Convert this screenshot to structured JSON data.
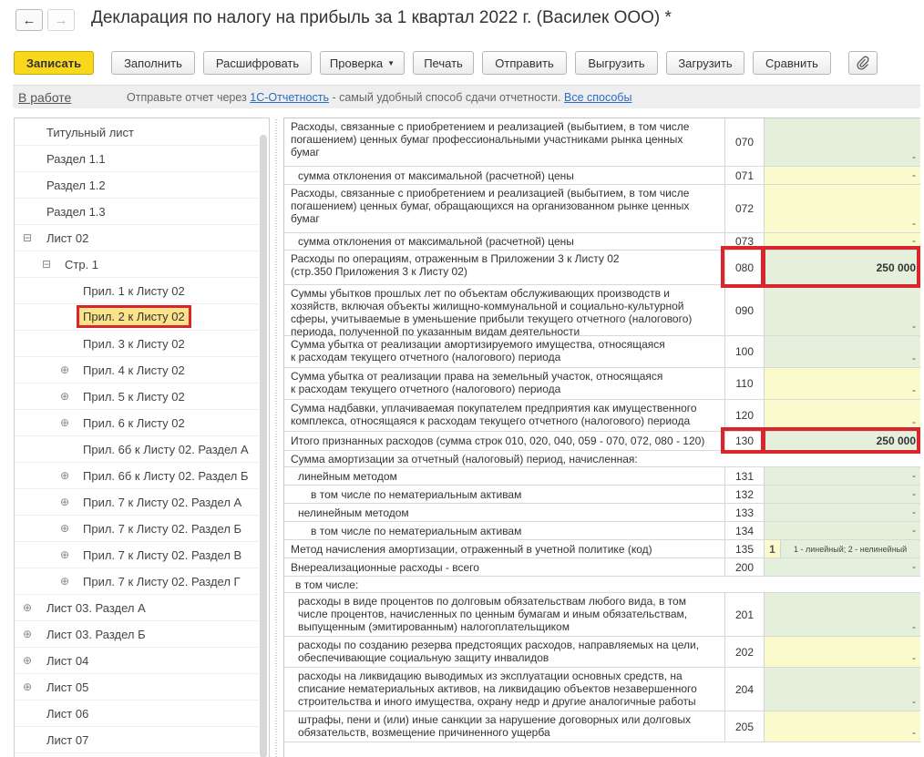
{
  "window": {
    "title": "Декларация по налогу на прибыль за 1 квартал 2022 г. (Василек ООО) *",
    "back_glyph": "←",
    "forward_glyph": "→"
  },
  "toolbar": {
    "save": "Записать",
    "fill": "Заполнить",
    "decode": "Расшифровать",
    "check": "Проверка",
    "print": "Печать",
    "send": "Отправить",
    "export": "Выгрузить",
    "import": "Загрузить",
    "compare": "Сравнить",
    "attach_icon": "paperclip-icon"
  },
  "status": {
    "state": "В работе",
    "message_prefix": "Отправьте отчет через ",
    "message_link": "1С-Отчетность",
    "message_suffix": " - самый удобный способ сдачи отчетности. ",
    "all_ways": "Все способы"
  },
  "tree": {
    "items": [
      {
        "label": "Титульный лист",
        "expander": ""
      },
      {
        "label": "Раздел 1.1",
        "expander": ""
      },
      {
        "label": "Раздел 1.2",
        "expander": ""
      },
      {
        "label": "Раздел 1.3",
        "expander": ""
      },
      {
        "label": "Лист 02",
        "expander": "⊟"
      },
      {
        "label": "Стр. 1",
        "expander": "⊟"
      },
      {
        "label": "Прил. 1 к Листу 02",
        "expander": ""
      },
      {
        "label": "Прил. 2 к Листу 02",
        "expander": "",
        "selected": true
      },
      {
        "label": "Прил. 3 к Листу 02",
        "expander": ""
      },
      {
        "label": "Прил. 4 к Листу 02",
        "expander": "⊕"
      },
      {
        "label": "Прил. 5 к Листу 02",
        "expander": "⊕"
      },
      {
        "label": "Прил. 6 к Листу 02",
        "expander": "⊕"
      },
      {
        "label": "Прил. 6б к Листу 02. Раздел А",
        "expander": ""
      },
      {
        "label": "Прил. 6б к Листу 02. Раздел Б",
        "expander": "⊕"
      },
      {
        "label": "Прил. 7 к Листу 02. Раздел А",
        "expander": "⊕"
      },
      {
        "label": "Прил. 7 к Листу 02. Раздел Б",
        "expander": "⊕"
      },
      {
        "label": "Прил. 7 к Листу 02. Раздел В",
        "expander": "⊕"
      },
      {
        "label": "Прил. 7 к Листу 02. Раздел Г",
        "expander": "⊕"
      },
      {
        "label": "Лист 03. Раздел А",
        "expander": "⊕"
      },
      {
        "label": "Лист 03. Раздел Б",
        "expander": "⊕"
      },
      {
        "label": "Лист 04",
        "expander": "⊕"
      },
      {
        "label": "Лист 05",
        "expander": "⊕"
      },
      {
        "label": "Лист 06",
        "expander": ""
      },
      {
        "label": "Лист 07",
        "expander": ""
      }
    ]
  },
  "form": {
    "rows": [
      {
        "lines": [
          "Расходы, связанные с приобретением и реализацией (выбытием, в том числе",
          "погашением) ценных бумаг профессиональными участниками рынка ценных",
          "бумаг"
        ],
        "code": "070",
        "value": "-",
        "color": "green"
      },
      {
        "lines": [
          "сумма отклонения от максимальной (расчетной) цены"
        ],
        "code": "071",
        "value": "-",
        "color": "yellow",
        "indent": 1
      },
      {
        "lines": [
          "Расходы, связанные с приобретением и реализацией (выбытием, в том числе",
          "погашением) ценных бумаг, обращающихся на организованном рынке ценных",
          "бумаг"
        ],
        "code": "072",
        "value": "-",
        "color": "yellow"
      },
      {
        "lines": [
          "сумма отклонения от максимальной (расчетной) цены"
        ],
        "code": "073",
        "value": "-",
        "color": "yellow",
        "indent": 1
      },
      {
        "lines": [
          "Расходы по операциям, отраженным в Приложении 3 к Листу 02",
          "(стр.350 Приложения 3 к Листу 02)"
        ],
        "code": "080",
        "value": "250 000",
        "color": "green",
        "bold": true,
        "highlight": true
      },
      {
        "lines": [
          "Суммы убытков прошлых лет по объектам обслуживающих производств и",
          "хозяйств, включая объекты жилищно-коммунальной и социально-культурной",
          "сферы, учитываемые в уменьшение прибыли текущего отчетного (налогового)",
          "периода, полученной по указанным видам деятельности"
        ],
        "code": "090",
        "value": "-",
        "color": "green"
      },
      {
        "lines": [
          "Сумма убытка от реализации амортизируемого имущества, относящаяся",
          "к расходам текущего отчетного (налогового) периода"
        ],
        "code": "100",
        "value": "-",
        "color": "green"
      },
      {
        "lines": [
          "Сумма убытка от реализации права на земельный участок, относящаяся",
          "к расходам текущего отчетного (налогового) периода"
        ],
        "code": "110",
        "value": "-",
        "color": "yellow"
      },
      {
        "lines": [
          "Сумма надбавки, уплачиваемая покупателем предприятия как имущественного",
          "комплекса, относящаяся к расходам текущего отчетного (налогового) периода"
        ],
        "code": "120",
        "value": "-",
        "color": "yellow"
      },
      {
        "lines": [
          "Итого признанных расходов (сумма строк 010, 020, 040, 059 - 070, 072, 080 - 120)"
        ],
        "code": "130",
        "value": "250 000",
        "color": "green",
        "bold": true,
        "highlight": true
      },
      {
        "lines": [
          "Сумма амортизации за отчетный (налоговый) период, начисленная:"
        ],
        "code": "",
        "value": "",
        "color": "",
        "full": true
      },
      {
        "lines": [
          "линейным методом"
        ],
        "code": "131",
        "value": "-",
        "color": "green",
        "indent": 1
      },
      {
        "lines": [
          "в том числе по нематериальным активам"
        ],
        "code": "132",
        "value": "-",
        "color": "green",
        "indent": 2
      },
      {
        "lines": [
          "нелинейным методом"
        ],
        "code": "133",
        "value": "-",
        "color": "green",
        "indent": 1
      },
      {
        "lines": [
          "в том числе по нематериальным активам"
        ],
        "code": "134",
        "value": "-",
        "color": "green",
        "indent": 2
      },
      {
        "lines": [
          "Метод начисления амортизации, отраженный в учетной политике (код)"
        ],
        "code": "135",
        "value": "",
        "color": "method",
        "method_code": "1",
        "method_hint": "1 - линейный; 2 - нелинейный"
      },
      {
        "lines": [
          "Внереализационные расходы - всего"
        ],
        "code": "200",
        "value": "-",
        "color": "green"
      },
      {
        "lines": [
          "в том числе:"
        ],
        "code": "",
        "value": "",
        "color": "",
        "full": true,
        "indent": 3
      },
      {
        "lines": [
          "расходы в виде процентов по долговым обязательствам любого вида, в том",
          "числе процентов, начисленных по ценным бумагам и иным обязательствам,",
          "выпущенным (эмитированным) налогоплательщиком"
        ],
        "code": "201",
        "value": "-",
        "color": "green",
        "indent": 1
      },
      {
        "lines": [
          "расходы по созданию резерва предстоящих расходов, направляемых на цели,",
          "обеспечивающие социальную защиту инвалидов"
        ],
        "code": "202",
        "value": "-",
        "color": "yellow",
        "indent": 1
      },
      {
        "lines": [
          "расходы на ликвидацию выводимых из эксплуатации основных средств, на",
          "списание нематериальных активов, на ликвидацию объектов незавершенного",
          "строительства и иного имущества, охрану недр и другие аналогичные работы"
        ],
        "code": "204",
        "value": "-",
        "color": "green",
        "indent": 1
      },
      {
        "lines": [
          "штрафы, пени и (или) иные санкции за нарушение договорных или долговых",
          "обязательств, возмещение причиненного ущерба"
        ],
        "code": "205",
        "value": "-",
        "color": "yellow",
        "indent": 1
      },
      {
        "lines": [
          ""
        ],
        "code": "",
        "value": "",
        "color": ""
      }
    ]
  }
}
